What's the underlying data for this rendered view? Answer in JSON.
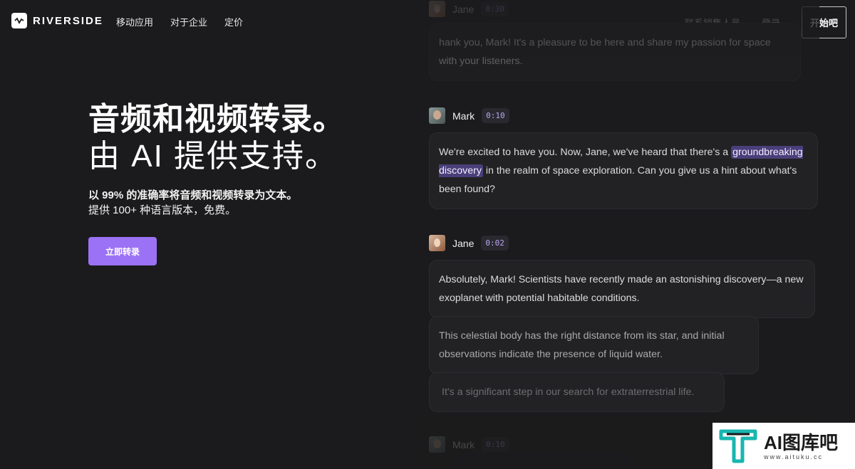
{
  "brand": {
    "name": "RIVERSIDE"
  },
  "nav": {
    "left": [
      "移动应用",
      "对于企业",
      "定价"
    ],
    "contact_sales": "联系销售人员",
    "login": "登录",
    "start": "开始吧"
  },
  "hero": {
    "title": "音频和视频转录。",
    "subtitle": "由 AI 提供支持。",
    "desc_line1": "以 99% 的准确率将音频和视频转录为文本。",
    "desc_line2": "提供 100+ 种语言版本，免费。",
    "button": "立即转录"
  },
  "transcript": {
    "top": {
      "name": "Jane",
      "time": "0:30",
      "text": "hank you, Mark! It's a pleasure to be here and share my passion for space with your listeners."
    },
    "mark": {
      "name": "Mark",
      "time": "0:10",
      "text_before": "We're excited to have you. Now, Jane, we've heard that there's a ",
      "highlight": "groundbreaking discovery",
      "text_after": " in the realm of space exploration. Can you give us a hint about what's been found?"
    },
    "jane": {
      "name": "Jane",
      "time": "0:02",
      "p1": "Absolutely, Mark! Scientists have recently made an astonishing discovery—a new exoplanet with potential habitable conditions.",
      "p2": " This celestial body has the right distance from its star, and initial observations indicate the presence of liquid water.",
      "p3": "It's a significant step in our search for extraterrestrial life."
    },
    "bottom": {
      "name": "Mark",
      "time": "0:10"
    }
  },
  "watermark": {
    "title": "AI图库吧",
    "url": "www.aituku.cc"
  },
  "colors": {
    "background": "#1b1b1d",
    "accent": "#9b72f5",
    "highlight": "#4a3f7a"
  }
}
